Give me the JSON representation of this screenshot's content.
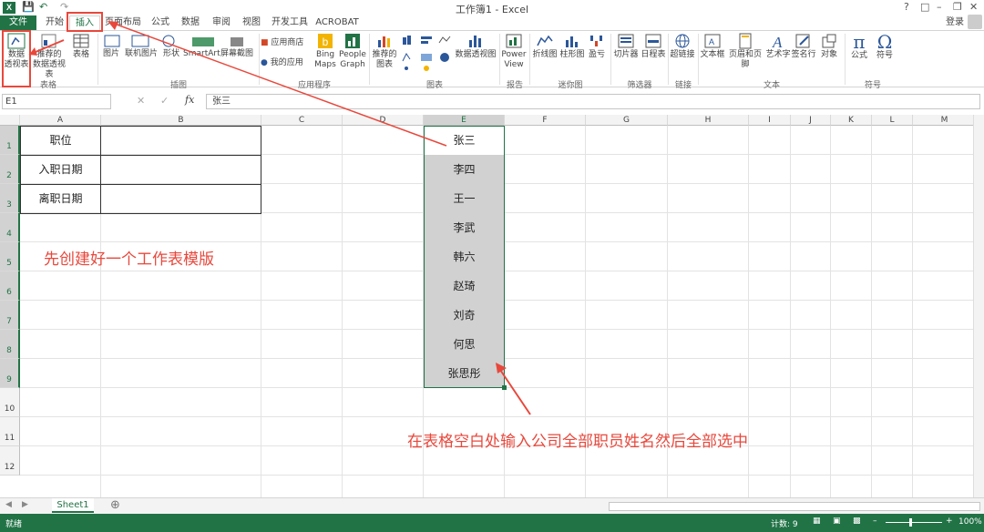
{
  "window": {
    "title": "工作簿1 - Excel",
    "help": "?",
    "signin": "登录"
  },
  "tabs": [
    {
      "label": "文件"
    },
    {
      "label": "开始"
    },
    {
      "label": "插入"
    },
    {
      "label": "页面布局"
    },
    {
      "label": "公式"
    },
    {
      "label": "数据"
    },
    {
      "label": "审阅"
    },
    {
      "label": "视图"
    },
    {
      "label": "开发工具"
    },
    {
      "label": "ACROBAT"
    }
  ],
  "ribbon": {
    "pivot_line1": "数据",
    "pivot_line2": "透视表",
    "rec_pivot_line1": "推荐的",
    "rec_pivot_line2": "数据透视表",
    "table": "表格",
    "picture": "图片",
    "online_picture": "联机图片",
    "shapes": "形状",
    "smartart": "SmartArt",
    "screenshot": "屏幕截图",
    "app_store": "应用商店",
    "my_apps": "我的应用",
    "bing_line1": "Bing",
    "bing_line2": "Maps",
    "people_line1": "People",
    "people_line2": "Graph",
    "rec_chart_line1": "推荐的",
    "rec_chart_line2": "图表",
    "pivot_chart": "数据透视图",
    "power_line1": "Power",
    "power_line2": "View",
    "line": "折线图",
    "column": "柱形图",
    "winloss": "盈亏",
    "slicer": "切片器",
    "timeline": "日程表",
    "hyperlink": "超链接",
    "textbox": "文本框",
    "header_footer": "页眉和页脚",
    "wordart": "艺术字",
    "signature": "签名行",
    "object": "对象",
    "equation": "公式",
    "symbol": "符号",
    "groups": {
      "tables": "表格",
      "illustrations": "插图",
      "apps": "应用程序",
      "charts": "图表",
      "reports": "报告",
      "sparklines": "迷你图",
      "filters": "筛选器",
      "links": "链接",
      "text": "文本",
      "symbols": "符号"
    }
  },
  "formula_bar": {
    "name_box": "E1",
    "fx": "fx",
    "content": "张三"
  },
  "columns": [
    "A",
    "B",
    "C",
    "D",
    "E",
    "F",
    "G",
    "H",
    "I",
    "J",
    "K",
    "L",
    "M"
  ],
  "rows": [
    "1",
    "2",
    "3",
    "4",
    "5",
    "6",
    "7",
    "8",
    "9",
    "10",
    "11",
    "12"
  ],
  "template_labels": [
    "职位",
    "入职日期",
    "离职日期"
  ],
  "names": [
    "张三",
    "李四",
    "王一",
    "李武",
    "韩六",
    "赵琦",
    "刘奇",
    "何思",
    "张思彤"
  ],
  "annotations": {
    "left": "先创建好一个工作表模版",
    "bottom": "在表格空白处输入公司全部职员姓名然后全部选中"
  },
  "sheet": {
    "tab": "Sheet1"
  },
  "status": {
    "ready": "就绪",
    "count": "计数: 9",
    "zoom": "100%"
  },
  "accent": "#217346",
  "annotation_color": "#e8483c"
}
